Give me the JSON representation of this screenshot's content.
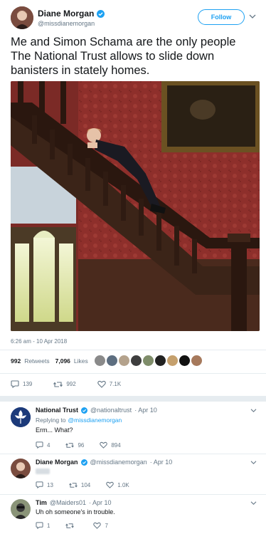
{
  "tweet": {
    "author_name": "Diane Morgan",
    "author_handle": "@missdianemorgan",
    "follow_label": "Follow",
    "text": "Me and Simon Schama are the only people The National Trust allows to slide down banisters in stately homes.",
    "timestamp": "6:26 am - 10 Apr 2018",
    "retweets_count": "992",
    "retweets_label": "Retweets",
    "likes_count": "7,096",
    "likes_label": "Likes",
    "replies": "139",
    "retweets": "992",
    "likes": "7.1K",
    "liker_avatar_count": 9
  },
  "replies": [
    {
      "name": "National Trust",
      "handle": "@nationaltrust",
      "date": "· Apr 10",
      "replying_prefix": "Replying to",
      "replying_to": "@missdianemorgan",
      "text": "Erm... What?",
      "replies": "4",
      "retweets": "96",
      "likes": "894"
    },
    {
      "name": "Diane Morgan",
      "handle": "@missdianemorgan",
      "date": "· Apr 10",
      "replies": "13",
      "retweets": "104",
      "likes": "1.0K"
    },
    {
      "name": "Tim",
      "handle": "@Maiders01",
      "date": "· Apr 10",
      "text": "Uh oh someone's in trouble.",
      "replies": "1",
      "retweets": "",
      "likes": "7"
    }
  ],
  "colors": {
    "accent": "#1da1f2",
    "verified": "#1da1f2",
    "muted": "#657786",
    "wall": "#8e2f2b",
    "wood": "#3b2418"
  }
}
